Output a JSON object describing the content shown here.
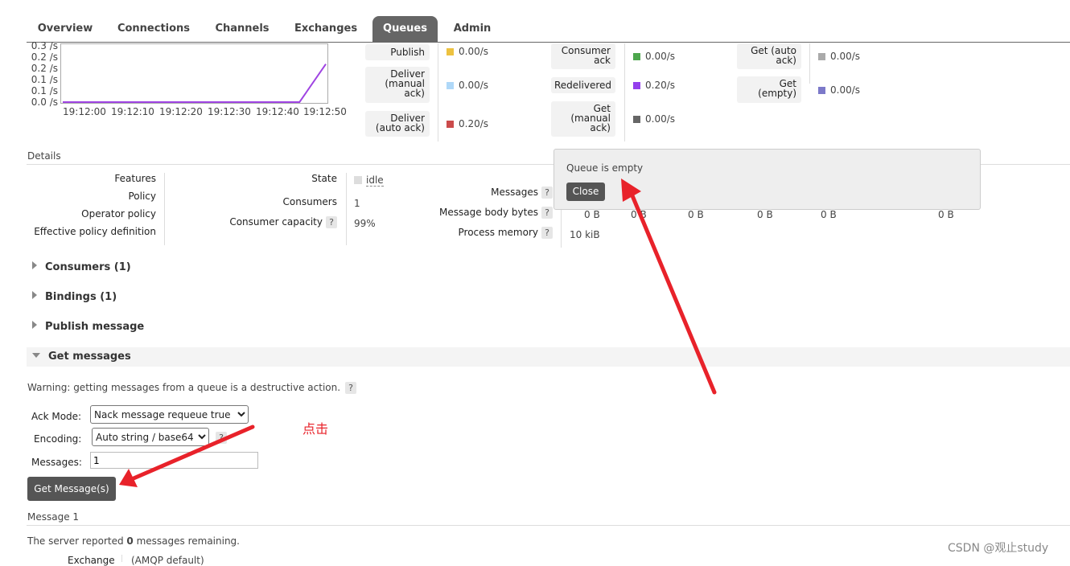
{
  "nav": {
    "tabs": [
      "Overview",
      "Connections",
      "Channels",
      "Exchanges",
      "Queues",
      "Admin"
    ],
    "active": "Queues"
  },
  "chart_data": {
    "type": "line",
    "y_ticks": [
      "0.3 /s",
      "0.2 /s",
      "0.2 /s",
      "0.1 /s",
      "0.1 /s",
      "0.0 /s"
    ],
    "x_ticks": [
      "19:12:00",
      "19:12:10",
      "19:12:20",
      "19:12:30",
      "19:12:40",
      "19:12:50"
    ],
    "series": [
      {
        "color": "#9f44e2",
        "x": [
          "19:12:00",
          "19:12:10",
          "19:12:20",
          "19:12:30",
          "19:12:40",
          "19:12:45",
          "19:12:50"
        ],
        "values": [
          0,
          0,
          0,
          0,
          0,
          0,
          0.2
        ]
      }
    ],
    "ylim": [
      0,
      0.3
    ]
  },
  "rates": {
    "col1": [
      {
        "label": "Publish",
        "value": "0.00/s",
        "color": "#edc240"
      },
      {
        "label": "Deliver\n(manual\nack)",
        "value": "0.00/s",
        "color": "#afd8f8"
      },
      {
        "label": "Deliver\n(auto ack)",
        "value": "0.20/s",
        "color": "#cb4b4b"
      }
    ],
    "col2": [
      {
        "label": "Consumer\nack",
        "value": "0.00/s",
        "color": "#4da74d"
      },
      {
        "label": "Redelivered",
        "value": "0.20/s",
        "color": "#9440ed"
      },
      {
        "label": "Get\n(manual\nack)",
        "value": "0.00/s",
        "color": "#666666"
      }
    ],
    "col3": [
      {
        "label": "Get (auto\nack)",
        "value": "0.00/s",
        "color": "#aaaaaa"
      },
      {
        "label": "Get\n(empty)",
        "value": "0.00/s",
        "color": "#7c79c9"
      }
    ]
  },
  "details": {
    "heading": "Details",
    "left_labels": [
      "Features",
      "Policy",
      "Operator policy",
      "Effective policy definition"
    ],
    "state_label": "State",
    "state_value": "idle",
    "consumers_label": "Consumers",
    "consumers_value": "1",
    "capacity_label": "Consumer capacity",
    "capacity_value": "99%",
    "messages_label": "Messages",
    "body_bytes_label": "Message body bytes",
    "body_bytes_values": [
      "0 B",
      "0 B",
      "0 B",
      "0 B",
      "0 B",
      "0 B"
    ],
    "process_memory_label": "Process memory",
    "process_memory_value": "10 kiB",
    "help": "?"
  },
  "popup": {
    "message": "Queue is empty",
    "close": "Close"
  },
  "sections": {
    "consumers": "Consumers (1)",
    "bindings": "Bindings (1)",
    "publish": "Publish message",
    "get": "Get messages"
  },
  "get_messages": {
    "warning": "Warning: getting messages from a queue is a destructive action.",
    "ack_mode_label": "Ack Mode:",
    "ack_mode_value": "Nack message requeue true",
    "encoding_label": "Encoding:",
    "encoding_value": "Auto string / base64",
    "messages_label": "Messages:",
    "messages_value": "1",
    "button": "Get Message(s)"
  },
  "result": {
    "title": "Message 1",
    "remaining_prefix": "The server reported ",
    "remaining_count": "0",
    "remaining_suffix": " messages remaining.",
    "exchange_label": "Exchange",
    "exchange_value": "(AMQP default)"
  },
  "annotation": {
    "text": "点击",
    "color": "#e8222a"
  },
  "watermark": "CSDN @观止study"
}
